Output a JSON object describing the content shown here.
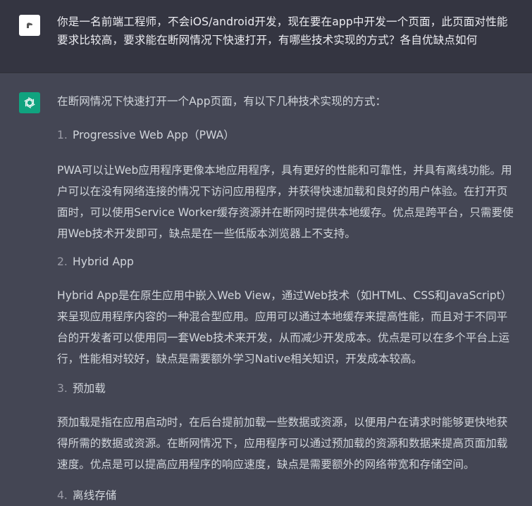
{
  "user_message": {
    "text": "你是一名前端工程师，不会iOS/android开发，现在要在app中开发一个页面，此页面对性能要求比较高，要求能在断网情况下快速打开，有哪些技术实现的方式？各自优缺点如何"
  },
  "assistant_message": {
    "intro": "在断网情况下快速打开一个App页面，有以下几种技术实现的方式：",
    "items": [
      {
        "number": "1.",
        "title": "Progressive Web App（PWA）",
        "body": "PWA可以让Web应用程序更像本地应用程序，具有更好的性能和可靠性，并具有离线功能。用户可以在没有网络连接的情况下访问应用程序，并获得快速加载和良好的用户体验。在打开页面时，可以使用Service Worker缓存资源并在断网时提供本地缓存。优点是跨平台，只需要使用Web技术开发即可，缺点是在一些低版本浏览器上不支持。"
      },
      {
        "number": "2.",
        "title": "Hybrid App",
        "body": "Hybrid App是在原生应用中嵌入Web View，通过Web技术（如HTML、CSS和JavaScript）来呈现应用程序内容的一种混合型应用。应用可以通过本地缓存来提高性能，而且对于不同平台的开发者可以使用同一套Web技术来开发，从而减少开发成本。优点是可以在多个平台上运行，性能相对较好，缺点是需要额外学习Native相关知识，开发成本较高。"
      },
      {
        "number": "3.",
        "title": "预加载",
        "body": "预加载是指在应用启动时，在后台提前加载一些数据或资源，以便用户在请求时能够更快地获得所需的数据或资源。在断网情况下，应用程序可以通过预加载的资源和数据来提高页面加载速度。优点是可以提高应用程序的响应速度，缺点是需要额外的网络带宽和存储空间。"
      },
      {
        "number": "4.",
        "title": "离线存储"
      }
    ]
  },
  "colors": {
    "user_bg": "#343541",
    "assistant_bg": "#444654",
    "gpt_avatar": "#10a37f",
    "text": "#d1d5db"
  }
}
